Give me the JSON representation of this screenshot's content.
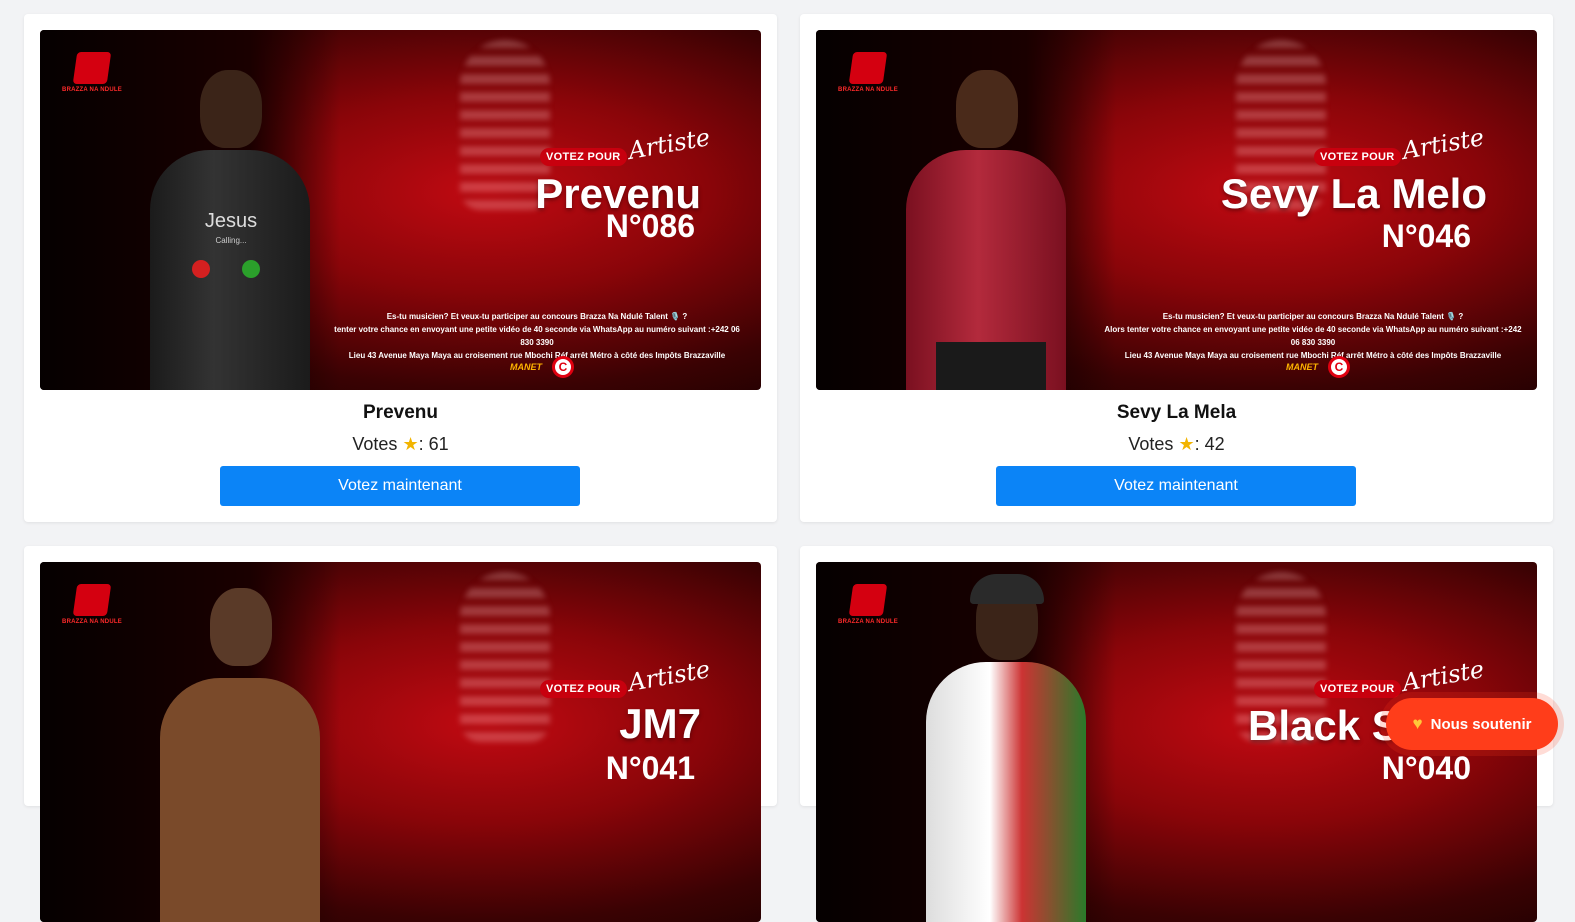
{
  "cards": [
    {
      "display_name": "Prevenu",
      "votes_label": "Votes",
      "votes_count": ": 61",
      "vote_button": "Votez maintenant",
      "poster": {
        "votez": "VOTEZ POUR",
        "artiste": "Artiste",
        "name": "Prevenu",
        "number": "N°086",
        "info_1": "Es-tu musicien? Et veux-tu participer au concours Brazza Na Ndulé Talent 🎙️ ?",
        "info_2": "tenter votre chance en envoyant une petite vidéo de 40 seconde via WhatsApp au numéro suivant :+242 06 830 3390",
        "info_3": "Lieu 43 Avenue Maya Maya au croisement rue Mbochi Réf arrêt Métro à côté des Impôts Brazzaville",
        "phone_text": "Jesus",
        "phone_sub": "Calling..."
      }
    },
    {
      "display_name": "Sevy La Mela",
      "votes_label": "Votes",
      "votes_count": ": 42",
      "vote_button": "Votez maintenant",
      "poster": {
        "votez": "VOTEZ POUR",
        "artiste": "Artiste",
        "name": "Sevy La Melo",
        "number": "N°046",
        "info_1": "Es-tu musicien? Et veux-tu participer au concours Brazza Na Ndulé Talent 🎙️ ?",
        "info_2": "Alors tenter votre chance en envoyant une petite vidéo de 40 seconde via WhatsApp au numéro suivant :+242 06 830 3390",
        "info_3": "Lieu 43 Avenue Maya Maya au croisement rue Mbochi Réf arrêt Métro à côté des Impôts Brazzaville"
      }
    },
    {
      "poster": {
        "votez": "VOTEZ POUR",
        "artiste": "Artiste",
        "name": "JM7",
        "number": "N°041"
      }
    },
    {
      "poster": {
        "votez": "VOTEZ POUR",
        "artiste": "Artiste",
        "name": "Black S",
        "number": "N°040"
      }
    }
  ],
  "logo_text": "BRAZZA NA NDULE",
  "sponsor_1": "MANET",
  "sponsor_2": "C",
  "support_button": "Nous soutenir",
  "colors": {
    "vote_button": "#0b84f7",
    "support_button": "#ff3d1a",
    "poster_red": "#c10a12"
  }
}
